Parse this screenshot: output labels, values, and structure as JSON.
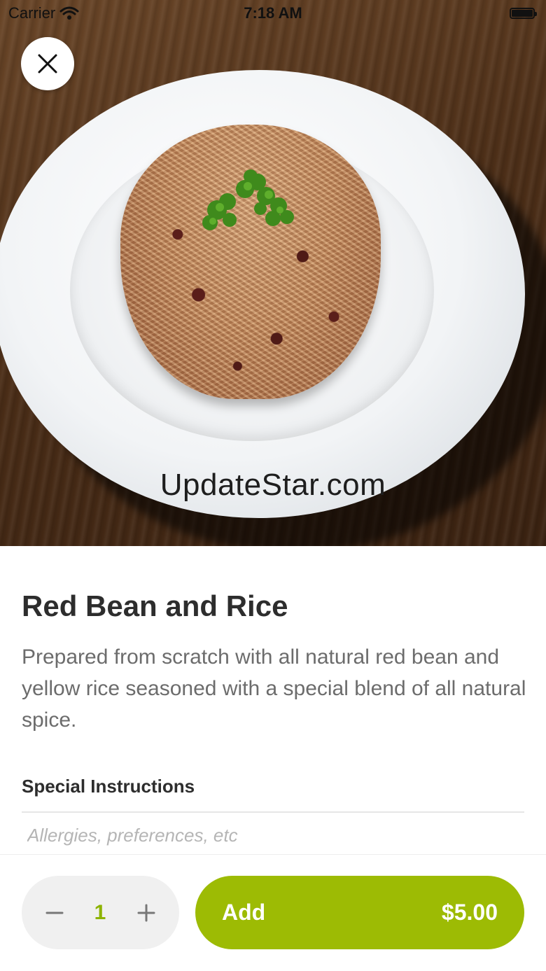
{
  "status_bar": {
    "carrier": "Carrier",
    "time": "7:18 AM",
    "wifi_icon": "wifi-icon",
    "battery_icon": "battery-icon"
  },
  "hero": {
    "image": "red-bean-and-rice-photo",
    "watermark": "UpdateStar.com"
  },
  "close_icon": "close-icon",
  "item": {
    "name": "Red Bean and Rice",
    "description": "Prepared from scratch with all natural red bean and yellow rice seasoned with a special blend of all natural spice."
  },
  "special_instructions": {
    "label": "Special Instructions",
    "value": "",
    "placeholder": "Allergies, preferences, etc"
  },
  "quantity": {
    "value": "1",
    "minus_icon": "minus-icon",
    "plus_icon": "plus-icon"
  },
  "add_button": {
    "label": "Add",
    "price": "$5.00"
  },
  "colors": {
    "accent": "#9dbb04",
    "quantity_text": "#8db300",
    "title_text": "#2d2d2d",
    "body_text": "#6c6c6c",
    "placeholder_text": "#b5b5b5",
    "stepper_bg": "#f0f0f0"
  }
}
